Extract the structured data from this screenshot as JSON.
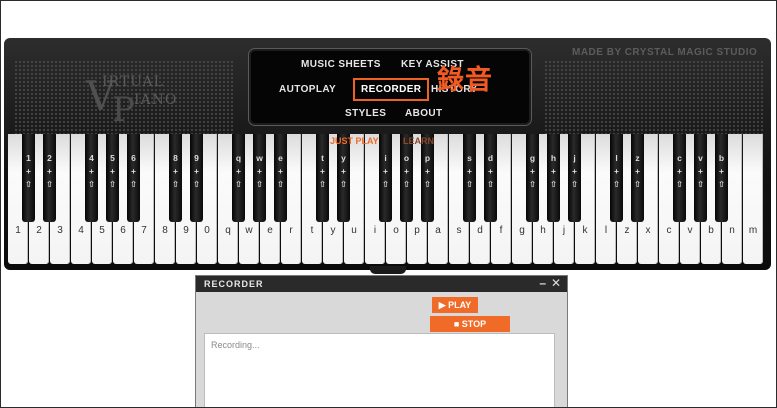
{
  "logo": {
    "line1": "IRTUAL",
    "line2": "IANO",
    "v": "V",
    "p": "P"
  },
  "made_by": "MADE BY CRYSTAL MAGIC STUDIO",
  "menu": {
    "music_sheets": "MUSIC SHEETS",
    "key_assist": "KEY ASSIST",
    "autoplay": "AUTOPLAY",
    "recorder": "RECORDER",
    "history": "HISTORY",
    "styles": "STYLES",
    "about": "ABOUT"
  },
  "annotation": "錄音",
  "submodes": {
    "just_play": "JUST PLAY",
    "learn": "LEARN"
  },
  "white_keys": [
    "1",
    "2",
    "3",
    "4",
    "5",
    "6",
    "7",
    "8",
    "9",
    "0",
    "q",
    "w",
    "e",
    "r",
    "t",
    "y",
    "u",
    "i",
    "o",
    "p",
    "a",
    "s",
    "d",
    "f",
    "g",
    "h",
    "j",
    "k",
    "l",
    "z",
    "x",
    "c",
    "v",
    "b",
    "n",
    "m"
  ],
  "black_keys": [
    {
      "after": 0,
      "label": "1\n+\n⇧"
    },
    {
      "after": 1,
      "label": "2\n+\n⇧"
    },
    {
      "after": 3,
      "label": "4\n+\n⇧"
    },
    {
      "after": 4,
      "label": "5\n+\n⇧"
    },
    {
      "after": 5,
      "label": "6\n+\n⇧"
    },
    {
      "after": 7,
      "label": "8\n+\n⇧"
    },
    {
      "after": 8,
      "label": "9\n+\n⇧"
    },
    {
      "after": 10,
      "label": "q\n+\n⇧"
    },
    {
      "after": 11,
      "label": "w\n+\n⇧"
    },
    {
      "after": 12,
      "label": "e\n+\n⇧"
    },
    {
      "after": 14,
      "label": "t\n+\n⇧"
    },
    {
      "after": 15,
      "label": "y\n+\n⇧"
    },
    {
      "after": 17,
      "label": "i\n+\n⇧"
    },
    {
      "after": 18,
      "label": "o\n+\n⇧"
    },
    {
      "after": 19,
      "label": "p\n+\n⇧"
    },
    {
      "after": 21,
      "label": "s\n+\n⇧"
    },
    {
      "after": 22,
      "label": "d\n+\n⇧"
    },
    {
      "after": 24,
      "label": "g\n+\n⇧"
    },
    {
      "after": 25,
      "label": "h\n+\n⇧"
    },
    {
      "after": 26,
      "label": "j\n+\n⇧"
    },
    {
      "after": 28,
      "label": "l\n+\n⇧"
    },
    {
      "after": 29,
      "label": "z\n+\n⇧"
    },
    {
      "after": 31,
      "label": "c\n+\n⇧"
    },
    {
      "after": 32,
      "label": "v\n+\n⇧"
    },
    {
      "after": 33,
      "label": "b\n+\n⇧"
    }
  ],
  "recorder": {
    "title": "RECORDER",
    "minimize": "–",
    "close": "✕",
    "play_label": "▶ PLAY",
    "stop_label": "■ STOP",
    "placeholder": "Recording..."
  }
}
